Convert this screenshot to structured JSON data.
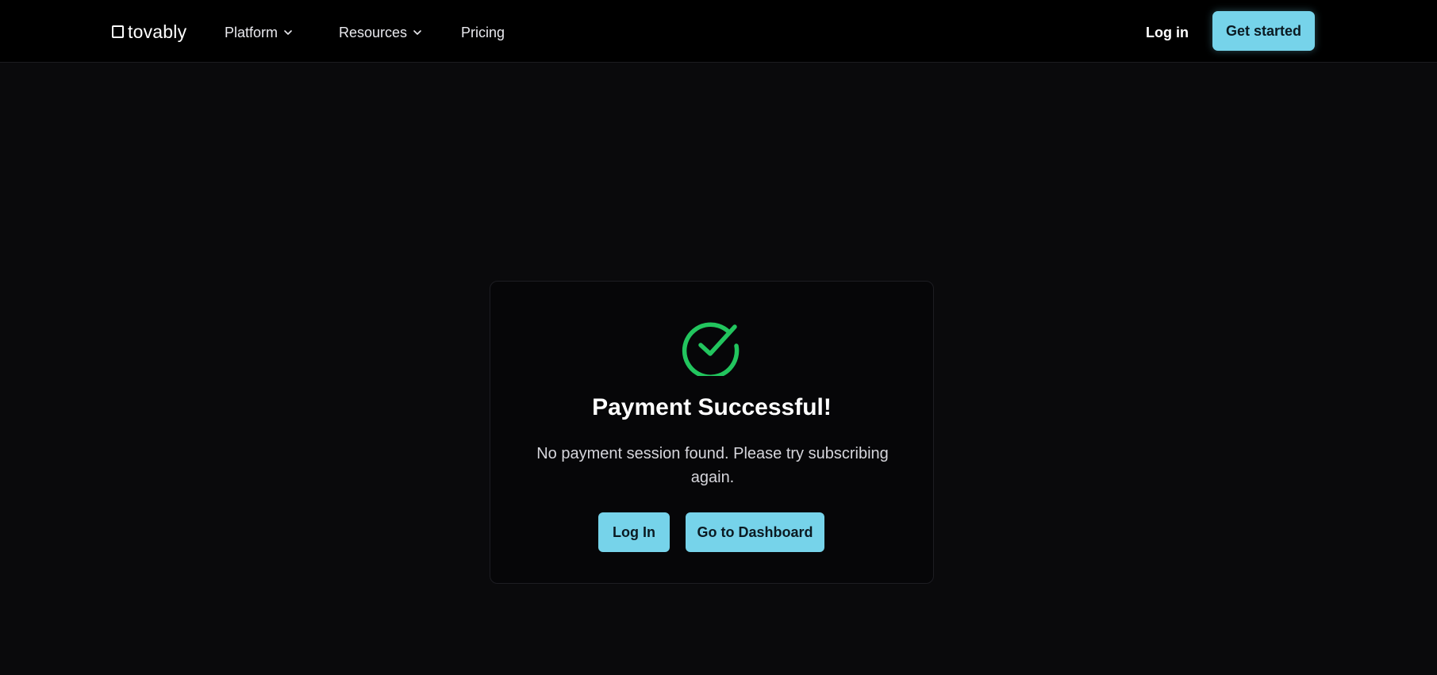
{
  "nav": {
    "logo_text": "tovably",
    "items": [
      {
        "label": "Platform",
        "has_dropdown": true
      },
      {
        "label": "Resources",
        "has_dropdown": true
      },
      {
        "label": "Pricing",
        "has_dropdown": false
      }
    ],
    "login_label": "Log in",
    "cta_label": "Get started"
  },
  "card": {
    "icon": "check-circle-icon",
    "title": "Payment Successful!",
    "message": "No payment session found. Please try subscribing again.",
    "buttons": {
      "login_label": "Log In",
      "dashboard_label": "Go to Dashboard"
    }
  },
  "colors": {
    "accent": "#76d3ea",
    "success": "#22c55e",
    "background": "#0a0a0c",
    "nav_background": "#000000"
  }
}
